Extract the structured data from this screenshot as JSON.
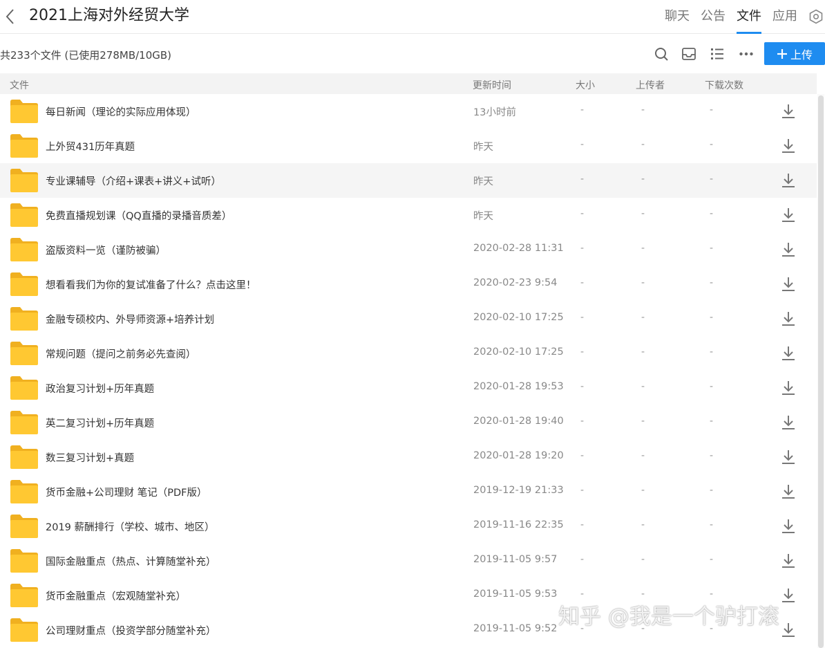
{
  "header": {
    "title": "2021上海对外经贸大学",
    "tabs": [
      {
        "label": "聊天",
        "active": false
      },
      {
        "label": "公告",
        "active": false
      },
      {
        "label": "文件",
        "active": true
      },
      {
        "label": "应用",
        "active": false
      }
    ]
  },
  "toolbar": {
    "summary": "共233个文件 (已使用278MB/10GB)",
    "upload_label": "上传",
    "icons": [
      "search-icon",
      "inbox-icon",
      "list-view-icon",
      "more-icon"
    ]
  },
  "columns": {
    "name": "文件",
    "time": "更新时间",
    "size": "大小",
    "uploader": "上传者",
    "downloads": "下载次数"
  },
  "files": [
    {
      "name": "每日新闻（理论的实际应用体现）",
      "time": "13小时前",
      "size": "-",
      "uploader": "-",
      "downloads": "-"
    },
    {
      "name": "上外贸431历年真题",
      "time": "昨天",
      "size": "-",
      "uploader": "-",
      "downloads": "-"
    },
    {
      "name": "专业课辅导（介绍+课表+讲义+试听）",
      "time": "昨天",
      "size": "-",
      "uploader": "-",
      "downloads": "-"
    },
    {
      "name": "免费直播规划课（QQ直播的录播音质差）",
      "time": "昨天",
      "size": "-",
      "uploader": "-",
      "downloads": "-"
    },
    {
      "name": "盗版资料一览（谨防被骗）",
      "time": "2020-02-28 11:31",
      "size": "-",
      "uploader": "-",
      "downloads": "-"
    },
    {
      "name": "想看看我们为你的复试准备了什么？点击这里！",
      "time": "2020-02-23 9:54",
      "size": "-",
      "uploader": "-",
      "downloads": "-"
    },
    {
      "name": "金融专硕校内、外导师资源+培养计划",
      "time": "2020-02-10 17:25",
      "size": "-",
      "uploader": "-",
      "downloads": "-"
    },
    {
      "name": "常规问题（提问之前务必先查阅）",
      "time": "2020-02-10 17:25",
      "size": "-",
      "uploader": "-",
      "downloads": "-"
    },
    {
      "name": "政治复习计划+历年真题",
      "time": "2020-01-28 19:53",
      "size": "-",
      "uploader": "-",
      "downloads": "-"
    },
    {
      "name": "英二复习计划+历年真题",
      "time": "2020-01-28 19:40",
      "size": "-",
      "uploader": "-",
      "downloads": "-"
    },
    {
      "name": "数三复习计划+真题",
      "time": "2020-01-28 19:20",
      "size": "-",
      "uploader": "-",
      "downloads": "-"
    },
    {
      "name": "货币金融+公司理财 笔记（PDF版）",
      "time": "2019-12-19 21:33",
      "size": "-",
      "uploader": "-",
      "downloads": "-"
    },
    {
      "name": "2019 薪酬排行（学校、城市、地区）",
      "time": "2019-11-16 22:35",
      "size": "-",
      "uploader": "-",
      "downloads": "-"
    },
    {
      "name": "国际金融重点（热点、计算随堂补充）",
      "time": "2019-11-05 9:57",
      "size": "-",
      "uploader": "-",
      "downloads": "-"
    },
    {
      "name": "货币金融重点（宏观随堂补充）",
      "time": "2019-11-05 9:53",
      "size": "-",
      "uploader": "-",
      "downloads": "-"
    },
    {
      "name": "公司理财重点（投资学部分随堂补充）",
      "time": "2019-11-05 9:52",
      "size": "-",
      "uploader": "-",
      "downloads": "-"
    }
  ],
  "hovered_row": 2,
  "watermark": "知乎 @我是一个驴打滚",
  "colors": {
    "accent": "#1e8cf0",
    "folder": "#ffc832",
    "folder_dark": "#f0b020"
  }
}
